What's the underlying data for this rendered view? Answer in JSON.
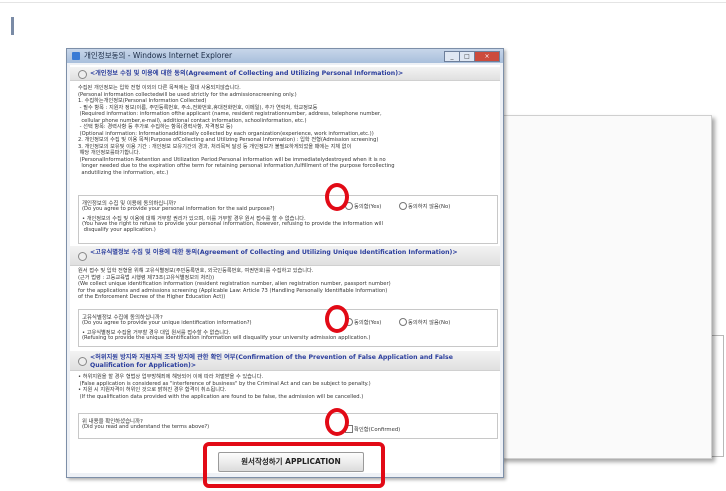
{
  "window": {
    "title": "개인정보동의 - Windows Internet Explorer"
  },
  "sections": [
    {
      "header": "<개인정보 수집 및 이용에 대한 동의(Agreement of Collecting and Utilizing Personal Information)>",
      "body": "수집된 개인정보는 입학 전형 이외의 다른 목적에는 절대 사용되지않습니다.\n(Personal information collectedwill be used strictly for the admissionscreening only.)\n1. 수집하는개인정보(Personal Information Collected)\n - 필수 항목 : 지원자 정보(이름, 주민등록번호, 주소,전화번호,휴대전화번호, 이메일), 추가 연락처, 학교정보등\n (Required information: information ofthe applicant (name, resident registrationnumber, address, telephone number,\n  cellular phone number,e-mail), additional contact information, schoolinformation, etc.)\n - 선택 항목: 경력사항 등 추가로 수집하는 항목(경력사항, 자격정보 등)\n (Optional information: Informationadditionally collected by each organization(experience, work information,etc.))\n2. 개인정보의 수집 및 이용 목적(Purpose ofCollecting and Utilizing Personal Information) : 입학 전형(Admission screening)\n3. 개인정보의 보유및 이용 기간 : 개인정보 보유기간의 경과, 처리목적 달성 등 개인정보가 불필요하게되었을 때에는 지체 없이\n 해당 개인정보를파기합니다.\n (PersonalInformation Retention and Utilization Period:Personal information will be immediatelydestroyed when it is no\n  longer needed due to the expiration ofthe term for retaining personal information,fulfillment of the purpose forcollecting\n  andutilizing the information, etc.)",
      "question_ko": "개인정보의 수집 및 이용에 동의하십니까?",
      "question_en": "(Do you agree to provide your personal information for the said purpose?)",
      "note_ko": "• 개인정보의 수집 및 이용에 대해 거부할 권리가 있으며, 이를 거부할 경우 원서 접수를 할 수 없습니다.",
      "note_en": "(You have the right to refuse to provide your personal information, however, refusing to provide the information will\n disqualify your application.)",
      "option_yes": "동의함(Yes)",
      "option_no": "동의하지 않음(No)"
    },
    {
      "header": "<고유식별정보 수집 및 이용에 대한 동의(Agreement of Collecting and Utilizing Unique Identification Information)>",
      "body": "원서 접수 및 입학 전형을 위해 고유식별정보(주민등록번호, 외국인등록번호, 여권번호)를 수집하고 있습니다.\n(근거 법령 : 고등교육법 시행령 제73조(고유식별정보의 처리))\n(We collect unique identification information (resident registration number, alien registration number, passport number)\nfor the applications and admissions screening (Applicable Law: Article 73 (Handling Personally Identifiable Information)\nof the Enforcement Decree of the Higher Education Act))",
      "question_ko": "고유식별정보 수집에 동의하십니까?",
      "question_en": "(Do you agree to provide your unique identification information?)",
      "note_ko": "• 고유식별정보 수집을 거부할 경우 대입 원서를 접수할 수 없습니다.",
      "note_en": "(Refusing to provide the unique identification information will disqualify your university admission application.)",
      "option_yes": "동의함(Yes)",
      "option_no": "동의하지 않음(No)"
    },
    {
      "header": "<허위지원 방지와 지원자격 조작 방지에 관한 확인 여부(Confirmation of the Prevention of False Application and False Qualification for Application)>",
      "body": "• 허위지원을 할 경우 형법상 업무방해죄에 해당되어 이에 따라 처벌받을 수 있습니다.\n (False application is considered as \"interference of business\" by the Criminal Act and can be subject to penalty.)\n• 지원 시 지원자격이 허위인 것으로 밝혀진 경우 합격이 취소됩니다.\n (If the qualification data provided with the application are found to be false, the admission will be cancelled.)",
      "question_ko": "위 내용을 확인하셨습니까?",
      "question_en": "(Did you read and understand the terms above?)",
      "option_confirm": "확인함(Confirmed)"
    }
  ],
  "submit_button": "원서작성하기 APPLICATION"
}
